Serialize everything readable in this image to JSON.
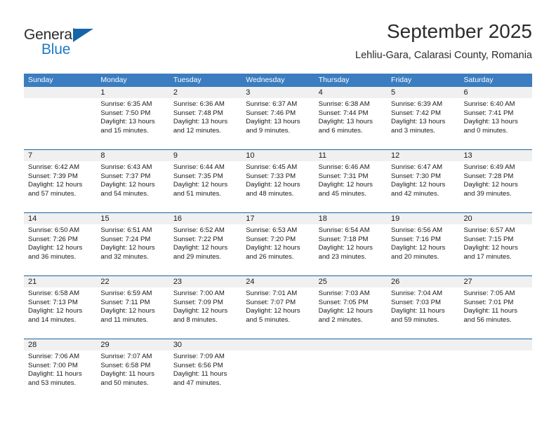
{
  "brand": {
    "name_part1": "General",
    "name_part2": "Blue",
    "accent_color": "#1f7ac4",
    "triangle_color": "#1565a8"
  },
  "header": {
    "month_title": "September 2025",
    "location": "Lehliu-Gara, Calarasi County, Romania"
  },
  "calendar": {
    "header_bg": "#3b7dc0",
    "row_divider_color": "#1b63a5",
    "daynum_bg": "#f0f0f0",
    "day_names": [
      "Sunday",
      "Monday",
      "Tuesday",
      "Wednesday",
      "Thursday",
      "Friday",
      "Saturday"
    ],
    "weeks": [
      [
        {
          "day": "",
          "blank": true
        },
        {
          "day": "1",
          "sunrise": "Sunrise: 6:35 AM",
          "sunset": "Sunset: 7:50 PM",
          "daylight": "Daylight: 13 hours and 15 minutes."
        },
        {
          "day": "2",
          "sunrise": "Sunrise: 6:36 AM",
          "sunset": "Sunset: 7:48 PM",
          "daylight": "Daylight: 13 hours and 12 minutes."
        },
        {
          "day": "3",
          "sunrise": "Sunrise: 6:37 AM",
          "sunset": "Sunset: 7:46 PM",
          "daylight": "Daylight: 13 hours and 9 minutes."
        },
        {
          "day": "4",
          "sunrise": "Sunrise: 6:38 AM",
          "sunset": "Sunset: 7:44 PM",
          "daylight": "Daylight: 13 hours and 6 minutes."
        },
        {
          "day": "5",
          "sunrise": "Sunrise: 6:39 AM",
          "sunset": "Sunset: 7:42 PM",
          "daylight": "Daylight: 13 hours and 3 minutes."
        },
        {
          "day": "6",
          "sunrise": "Sunrise: 6:40 AM",
          "sunset": "Sunset: 7:41 PM",
          "daylight": "Daylight: 13 hours and 0 minutes."
        }
      ],
      [
        {
          "day": "7",
          "sunrise": "Sunrise: 6:42 AM",
          "sunset": "Sunset: 7:39 PM",
          "daylight": "Daylight: 12 hours and 57 minutes."
        },
        {
          "day": "8",
          "sunrise": "Sunrise: 6:43 AM",
          "sunset": "Sunset: 7:37 PM",
          "daylight": "Daylight: 12 hours and 54 minutes."
        },
        {
          "day": "9",
          "sunrise": "Sunrise: 6:44 AM",
          "sunset": "Sunset: 7:35 PM",
          "daylight": "Daylight: 12 hours and 51 minutes."
        },
        {
          "day": "10",
          "sunrise": "Sunrise: 6:45 AM",
          "sunset": "Sunset: 7:33 PM",
          "daylight": "Daylight: 12 hours and 48 minutes."
        },
        {
          "day": "11",
          "sunrise": "Sunrise: 6:46 AM",
          "sunset": "Sunset: 7:31 PM",
          "daylight": "Daylight: 12 hours and 45 minutes."
        },
        {
          "day": "12",
          "sunrise": "Sunrise: 6:47 AM",
          "sunset": "Sunset: 7:30 PM",
          "daylight": "Daylight: 12 hours and 42 minutes."
        },
        {
          "day": "13",
          "sunrise": "Sunrise: 6:49 AM",
          "sunset": "Sunset: 7:28 PM",
          "daylight": "Daylight: 12 hours and 39 minutes."
        }
      ],
      [
        {
          "day": "14",
          "sunrise": "Sunrise: 6:50 AM",
          "sunset": "Sunset: 7:26 PM",
          "daylight": "Daylight: 12 hours and 36 minutes."
        },
        {
          "day": "15",
          "sunrise": "Sunrise: 6:51 AM",
          "sunset": "Sunset: 7:24 PM",
          "daylight": "Daylight: 12 hours and 32 minutes."
        },
        {
          "day": "16",
          "sunrise": "Sunrise: 6:52 AM",
          "sunset": "Sunset: 7:22 PM",
          "daylight": "Daylight: 12 hours and 29 minutes."
        },
        {
          "day": "17",
          "sunrise": "Sunrise: 6:53 AM",
          "sunset": "Sunset: 7:20 PM",
          "daylight": "Daylight: 12 hours and 26 minutes."
        },
        {
          "day": "18",
          "sunrise": "Sunrise: 6:54 AM",
          "sunset": "Sunset: 7:18 PM",
          "daylight": "Daylight: 12 hours and 23 minutes."
        },
        {
          "day": "19",
          "sunrise": "Sunrise: 6:56 AM",
          "sunset": "Sunset: 7:16 PM",
          "daylight": "Daylight: 12 hours and 20 minutes."
        },
        {
          "day": "20",
          "sunrise": "Sunrise: 6:57 AM",
          "sunset": "Sunset: 7:15 PM",
          "daylight": "Daylight: 12 hours and 17 minutes."
        }
      ],
      [
        {
          "day": "21",
          "sunrise": "Sunrise: 6:58 AM",
          "sunset": "Sunset: 7:13 PM",
          "daylight": "Daylight: 12 hours and 14 minutes."
        },
        {
          "day": "22",
          "sunrise": "Sunrise: 6:59 AM",
          "sunset": "Sunset: 7:11 PM",
          "daylight": "Daylight: 12 hours and 11 minutes."
        },
        {
          "day": "23",
          "sunrise": "Sunrise: 7:00 AM",
          "sunset": "Sunset: 7:09 PM",
          "daylight": "Daylight: 12 hours and 8 minutes."
        },
        {
          "day": "24",
          "sunrise": "Sunrise: 7:01 AM",
          "sunset": "Sunset: 7:07 PM",
          "daylight": "Daylight: 12 hours and 5 minutes."
        },
        {
          "day": "25",
          "sunrise": "Sunrise: 7:03 AM",
          "sunset": "Sunset: 7:05 PM",
          "daylight": "Daylight: 12 hours and 2 minutes."
        },
        {
          "day": "26",
          "sunrise": "Sunrise: 7:04 AM",
          "sunset": "Sunset: 7:03 PM",
          "daylight": "Daylight: 11 hours and 59 minutes."
        },
        {
          "day": "27",
          "sunrise": "Sunrise: 7:05 AM",
          "sunset": "Sunset: 7:01 PM",
          "daylight": "Daylight: 11 hours and 56 minutes."
        }
      ],
      [
        {
          "day": "28",
          "sunrise": "Sunrise: 7:06 AM",
          "sunset": "Sunset: 7:00 PM",
          "daylight": "Daylight: 11 hours and 53 minutes."
        },
        {
          "day": "29",
          "sunrise": "Sunrise: 7:07 AM",
          "sunset": "Sunset: 6:58 PM",
          "daylight": "Daylight: 11 hours and 50 minutes."
        },
        {
          "day": "30",
          "sunrise": "Sunrise: 7:09 AM",
          "sunset": "Sunset: 6:56 PM",
          "daylight": "Daylight: 11 hours and 47 minutes."
        },
        {
          "day": "",
          "blank": true
        },
        {
          "day": "",
          "blank": true
        },
        {
          "day": "",
          "blank": true
        },
        {
          "day": "",
          "blank": true
        }
      ]
    ]
  }
}
